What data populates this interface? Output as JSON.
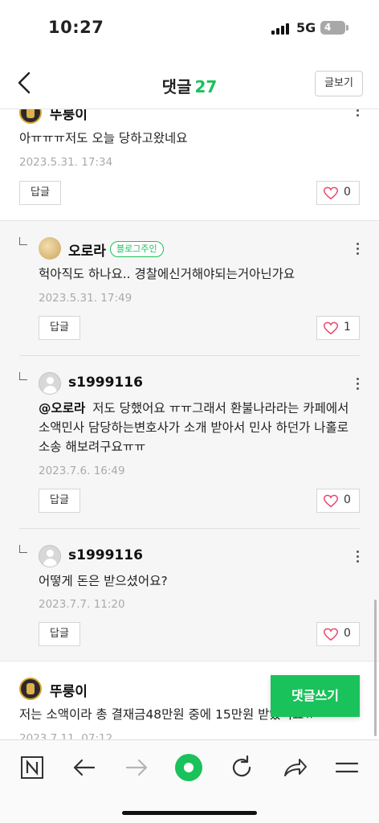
{
  "status_bar": {
    "time": "10:27",
    "network": "5G",
    "battery": "4"
  },
  "header": {
    "title": "댓글",
    "count": "27",
    "post_button": "글보기",
    "back_icon": "chevron-left-icon"
  },
  "buttons": {
    "reply": "답글"
  },
  "comments": [
    {
      "nickname": "뚜룽이",
      "text": "아ㅠㅠㅠ저도 오늘 당하고왔네요",
      "date": "2023.5.31. 17:34",
      "likes": "0"
    },
    {
      "nickname": "오로라",
      "badge": "블로그주인",
      "text": "헉아직도 하나요.. 경찰에신거해야되는거아닌가요",
      "date": "2023.5.31. 17:49",
      "likes": "1"
    },
    {
      "nickname": "s1999116",
      "mention": "@오로라",
      "text": "저도 당했어요 ㅠㅠ그래서 환불나라라는 카페에서 소액민사 담당하는변호사가 소개 받아서 민사 하던가 나홀로소송 해보려구요ㅠㅠ",
      "date": "2023.7.6. 16:49",
      "likes": "0"
    },
    {
      "nickname": "s1999116",
      "text": "어떻게 돈은 받으셨어요?",
      "date": "2023.7.7. 11:20",
      "likes": "0"
    },
    {
      "nickname": "뚜룽이",
      "text": "저는 소액이라 총 결재금48만원 중에 15만원 받았어요ㅠ",
      "date": "2023.7.11. 07:12"
    }
  ],
  "fab": {
    "label": "댓글쓰기"
  },
  "toolbar": {
    "icons": [
      "naver-n-icon",
      "back-arrow-icon",
      "forward-arrow-icon",
      "home-circle-icon",
      "refresh-icon",
      "share-icon",
      "menu-icon"
    ]
  },
  "colors": {
    "accent": "#19c25a",
    "heart": "#e8476b",
    "reply_bg": "#f6f6f6"
  }
}
